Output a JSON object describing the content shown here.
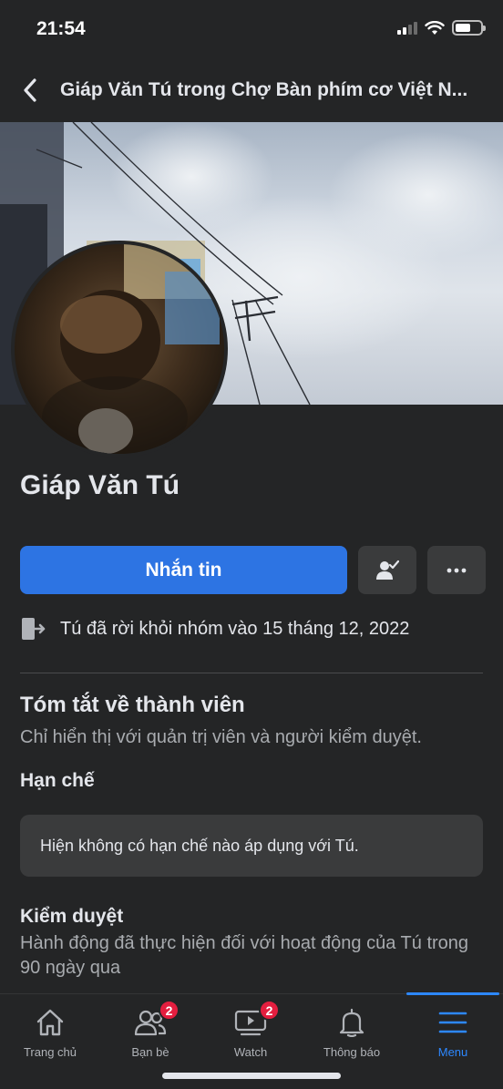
{
  "status_bar": {
    "time": "21:54"
  },
  "header": {
    "title": "Giáp Văn Tú trong Chợ Bàn phím cơ Việt N..."
  },
  "profile": {
    "name": "Giáp Văn Tú",
    "message_button": "Nhắn tin",
    "friend_icon": "person-check-icon",
    "more_icon": "more-icon",
    "left_group_text": "Tú đã rời khỏi nhóm vào 15 tháng 12, 2022"
  },
  "summary": {
    "title": "Tóm tắt về thành viên",
    "subtitle": "Chỉ hiển thị với quản trị viên và người kiểm duyệt."
  },
  "restrictions": {
    "title": "Hạn chế",
    "card_text": "Hiện không có hạn chế nào áp dụng với Tú."
  },
  "moderation": {
    "title": "Kiểm duyệt",
    "description_line1": "Hành động đã thực hiện đối với hoạt động của Tú trong",
    "description_line2": "90 ngày qua"
  },
  "bottom_nav": {
    "items": [
      {
        "label": "Trang chủ",
        "icon": "home-icon"
      },
      {
        "label": "Bạn bè",
        "icon": "friends-icon",
        "badge": "2"
      },
      {
        "label": "Watch",
        "icon": "watch-icon",
        "badge": "2"
      },
      {
        "label": "Thông báo",
        "icon": "bell-icon"
      },
      {
        "label": "Menu",
        "icon": "menu-icon",
        "active": true
      }
    ]
  },
  "colors": {
    "background": "#242526",
    "accent": "#2d74e3",
    "active_nav": "#2d88ff",
    "badge": "#e41e3f"
  }
}
